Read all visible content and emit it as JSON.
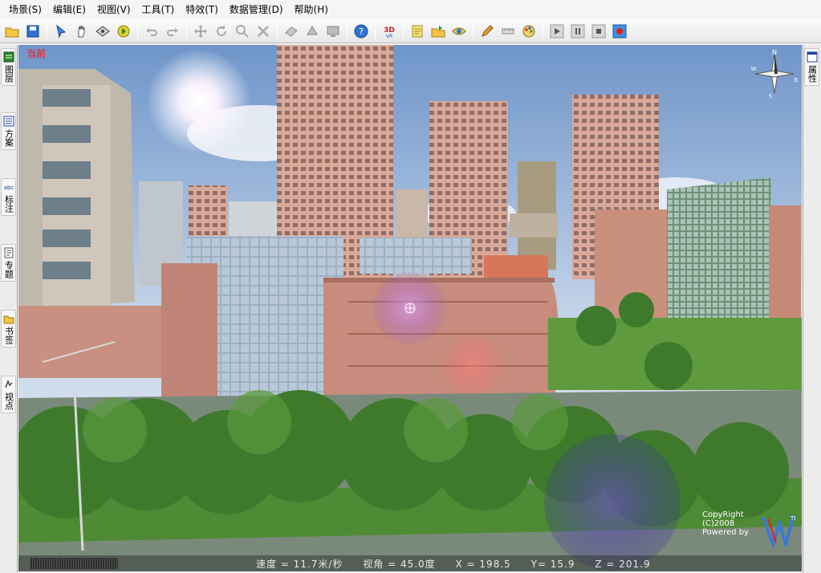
{
  "menu": {
    "items": [
      "场景(S)",
      "编辑(E)",
      "视图(V)",
      "工具(T)",
      "特效(T)",
      "数据管理(D)",
      "帮助(H)"
    ]
  },
  "toolbar": {
    "buttons": [
      "open-folder",
      "save",
      "select-arrow",
      "pan-hand",
      "fly-mode",
      "play-tour",
      "undo",
      "redo",
      "move",
      "rotate",
      "zoom",
      "delete",
      "object-a",
      "object-b",
      "object-c",
      "help",
      "3d-view",
      "note",
      "open-file",
      "eye-view",
      "draw-pencil",
      "measure",
      "palette",
      "play",
      "pause",
      "stop",
      "record"
    ]
  },
  "left_tabs": [
    {
      "label": "图层",
      "icon": "layers-icon"
    },
    {
      "label": "方案",
      "icon": "plan-icon"
    },
    {
      "label": "标注",
      "icon": "abc-label-icon"
    },
    {
      "label": "专题",
      "icon": "topic-icon"
    },
    {
      "label": "书签",
      "icon": "bookmark-folder-icon"
    },
    {
      "label": "视点",
      "icon": "viewpoint-icon"
    }
  ],
  "right_tabs": [
    {
      "label": "属性",
      "icon": "properties-icon"
    }
  ],
  "viewport": {
    "current_label": "当前",
    "compass": {
      "n": "N",
      "e": "E",
      "s": "S",
      "w": "W"
    }
  },
  "status": {
    "speed": "速度 = 11.7米/秒",
    "view_angle": "视角 = 45.0度",
    "x": "X = 198.5",
    "y": "Y= 15.9",
    "z": "Z = 201.9"
  },
  "copyright": {
    "line1": "CopyRight",
    "line2": "(C)2008",
    "line3": "Powered by",
    "tm": "TM"
  },
  "colors": {
    "sky": "#8fb3d9",
    "building_pink": "#d9a08f",
    "glass": "#9fb3c8",
    "tree": "#3f7a2c",
    "current_label": "#ff1010"
  }
}
